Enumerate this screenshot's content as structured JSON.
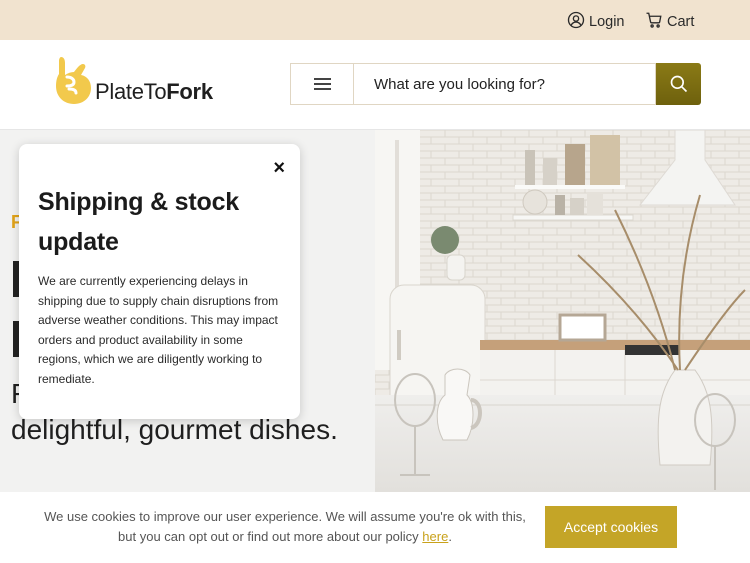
{
  "topbar": {
    "login_label": "Login",
    "cart_label": "Cart"
  },
  "logo": {
    "brand_regular": "PlateTo",
    "brand_bold": "Fork"
  },
  "search": {
    "placeholder": "What are you looking for?"
  },
  "hero": {
    "eyebrow": "F",
    "tagline": "F                            s for delightful, gourmet dishes."
  },
  "modal": {
    "close_label": "×",
    "title": "Shipping & stock update",
    "body": "We are currently experiencing delays in shipping due to supply chain disruptions from adverse weather conditions. This may impact orders and product availability in some regions, which we are diligently working to remediate."
  },
  "cookie": {
    "message_before": "We use cookies to improve our user experience. We will assume you're ok with this, but you can opt out or find out more about our policy ",
    "link_text": "here",
    "message_after": ".",
    "accept_label": "Accept cookies"
  },
  "colors": {
    "topbar_bg": "#f1e3cf",
    "accent": "#c4a527",
    "logo_yellow": "#f2c94c",
    "eyebrow": "#e1a319"
  },
  "icons": {
    "login": "user-circle-icon",
    "cart": "cart-icon",
    "menu": "hamburger-icon",
    "search": "search-icon"
  }
}
